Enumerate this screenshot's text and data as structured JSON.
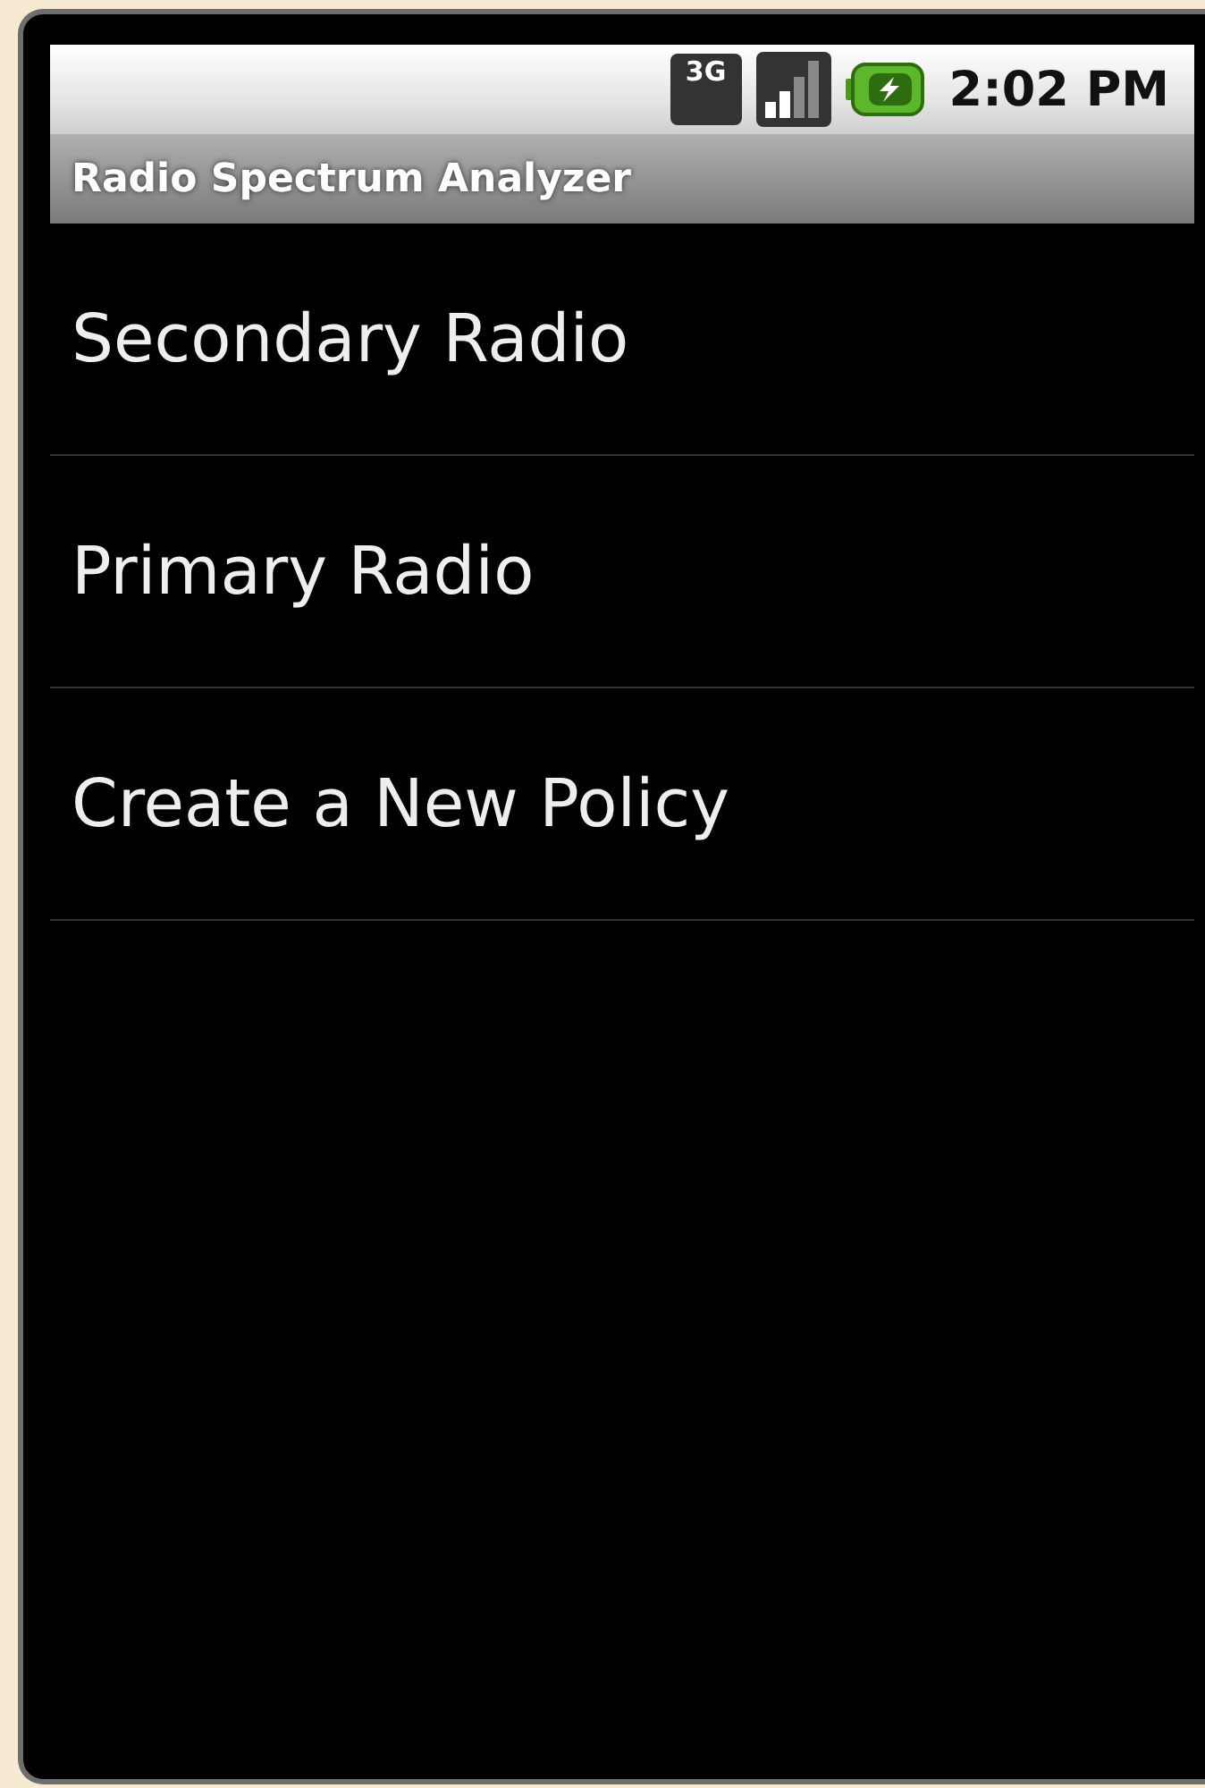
{
  "status_bar": {
    "network_type": "3G",
    "time": "2:02 PM"
  },
  "title_bar": {
    "title": "Radio Spectrum Analyzer"
  },
  "list": {
    "items": [
      {
        "label": "Secondary Radio"
      },
      {
        "label": "Primary Radio"
      },
      {
        "label": "Create a New Policy"
      }
    ]
  }
}
